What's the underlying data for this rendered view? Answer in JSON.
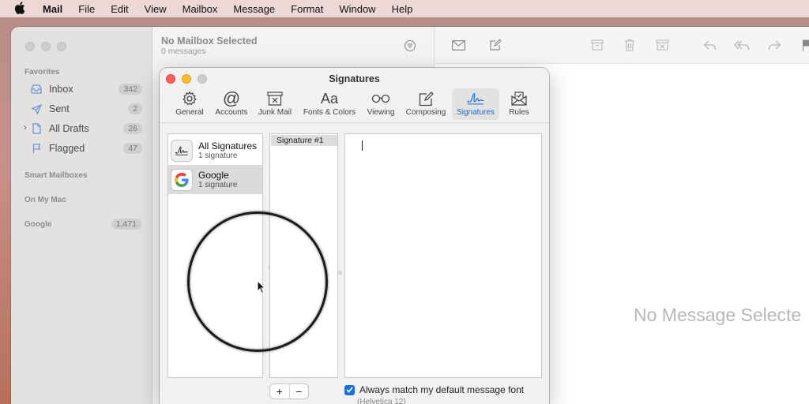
{
  "menubar": {
    "app": "Mail",
    "items": [
      "File",
      "Edit",
      "View",
      "Mailbox",
      "Message",
      "Format",
      "Window",
      "Help"
    ]
  },
  "sidebar": {
    "favorites_label": "Favorites",
    "items": [
      {
        "label": "Inbox",
        "count": "342",
        "icon": "inbox-tray-icon"
      },
      {
        "label": "Sent",
        "count": "2",
        "icon": "paper-plane-icon"
      },
      {
        "label": "All Drafts",
        "count": "26",
        "icon": "document-icon"
      },
      {
        "label": "Flagged",
        "count": "47",
        "icon": "flag-icon"
      }
    ],
    "smart_mailboxes_label": "Smart Mailboxes",
    "on_my_mac_label": "On My Mac",
    "google_label": "Google",
    "google_count": "1,471"
  },
  "message_list": {
    "title": "No Mailbox Selected",
    "subtitle": "0 messages"
  },
  "viewer": {
    "placeholder": "No Message Selecte"
  },
  "signatures_window": {
    "title": "Signatures",
    "tabs": [
      {
        "label": "General",
        "icon": "gear-icon"
      },
      {
        "label": "Accounts",
        "icon": "at-sign-icon"
      },
      {
        "label": "Junk Mail",
        "icon": "junk-mail-icon"
      },
      {
        "label": "Fonts & Colors",
        "icon": "fonts-icon"
      },
      {
        "label": "Viewing",
        "icon": "glasses-icon"
      },
      {
        "label": "Composing",
        "icon": "compose-icon"
      },
      {
        "label": "Signatures",
        "icon": "signature-icon"
      },
      {
        "label": "Rules",
        "icon": "rules-envelope-icon"
      }
    ],
    "active_tab": "Signatures",
    "accounts": [
      {
        "name": "All Signatures",
        "count": "1 signature"
      },
      {
        "name": "Google",
        "count": "1 signature"
      }
    ],
    "signature_name": "Signature #1",
    "add_label": "+",
    "remove_label": "−",
    "match_font_label": "Always match my default message font",
    "match_font_sub": "(Helvetica 12)",
    "match_font_checked": true
  },
  "colors": {
    "accent": "#1767d6",
    "close": "#fe5f57",
    "minimize": "#febc2e"
  }
}
